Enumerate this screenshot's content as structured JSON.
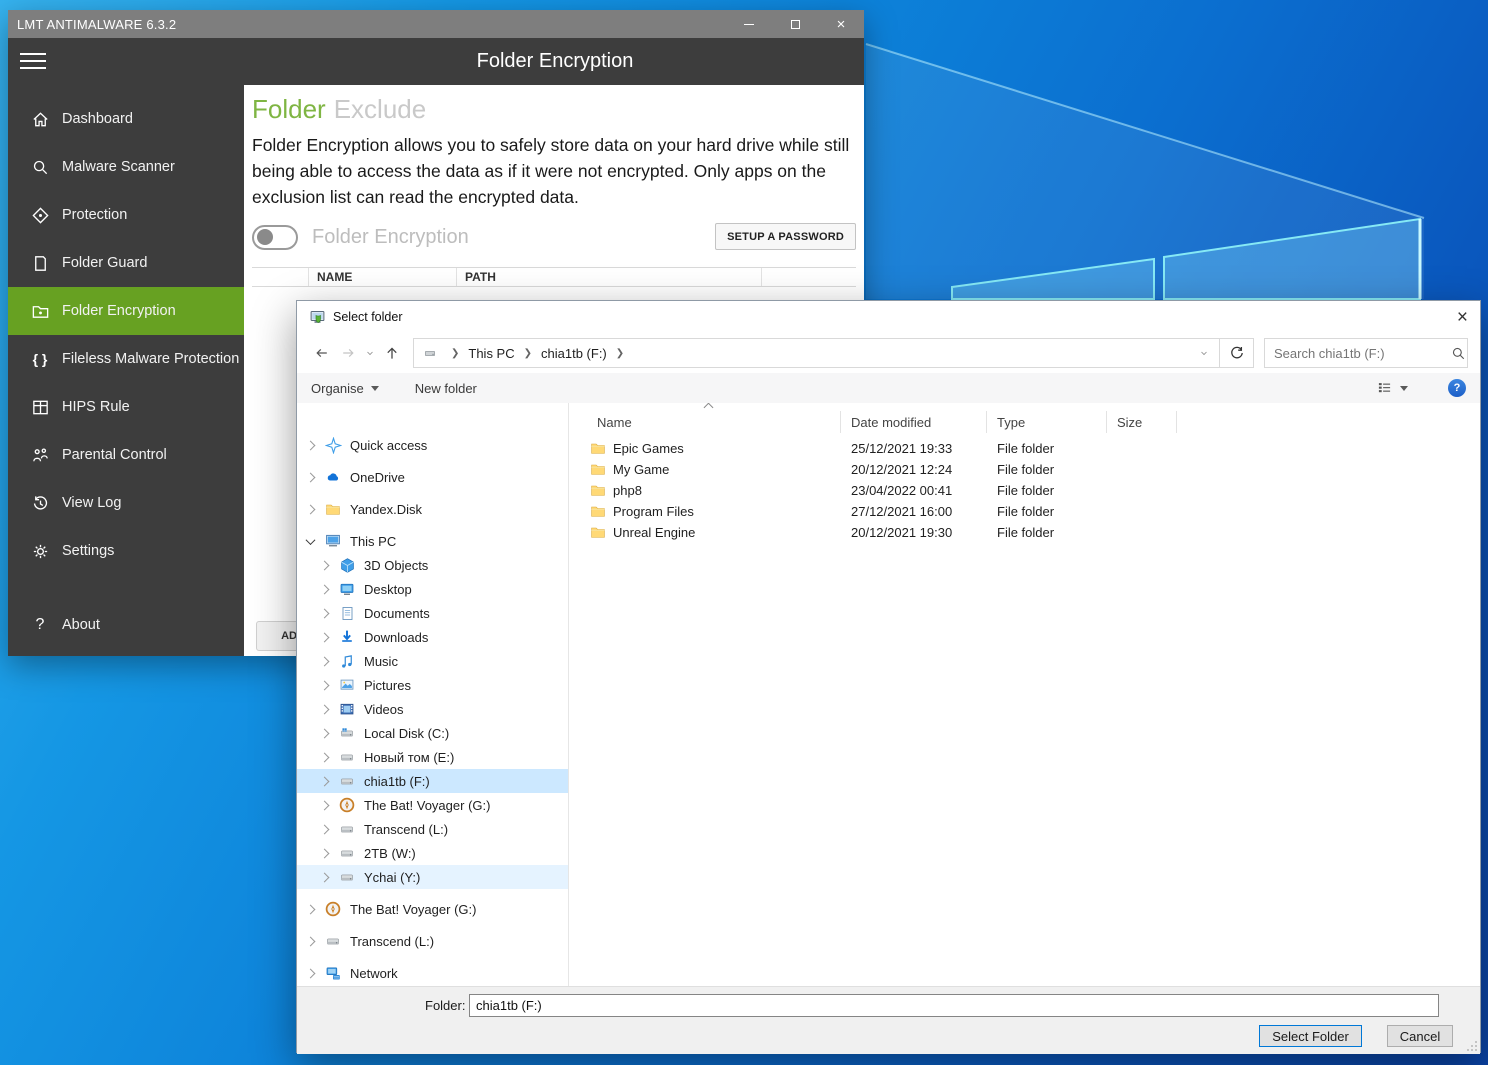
{
  "app": {
    "titlebar": {
      "title": "LMT ANTIMALWARE 6.3.2"
    },
    "header": {
      "title": "Folder Encryption"
    },
    "sidebar": {
      "items": [
        {
          "id": "dashboard",
          "label": "Dashboard",
          "icon": "home",
          "selected": false
        },
        {
          "id": "malware-scanner",
          "label": "Malware Scanner",
          "icon": "scan",
          "selected": false
        },
        {
          "id": "protection",
          "label": "Protection",
          "icon": "protection",
          "selected": false
        },
        {
          "id": "folder-guard",
          "label": "Folder Guard",
          "icon": "folder-guard",
          "selected": false
        },
        {
          "id": "folder-encryption",
          "label": "Folder Encryption",
          "icon": "folder-lock",
          "selected": true
        },
        {
          "id": "fileless-malware-protection",
          "label": "Fileless Malware Protection",
          "icon": "braces",
          "selected": false
        },
        {
          "id": "hips-rule",
          "label": "HIPS Rule",
          "icon": "hips",
          "selected": false
        },
        {
          "id": "parental-control",
          "label": "Parental Control",
          "icon": "parental",
          "selected": false
        },
        {
          "id": "view-log",
          "label": "View Log",
          "icon": "history",
          "selected": false
        },
        {
          "id": "settings",
          "label": "Settings",
          "icon": "gear",
          "selected": false
        },
        {
          "id": "about",
          "label": "About",
          "icon": "question",
          "selected": false
        }
      ]
    },
    "content": {
      "heading_primary": "Folder",
      "heading_secondary": "Exclude",
      "description": "Folder Encryption allows you to safely store data on your hard drive while still being able to access the data as if it were not encrypted. Only apps on the exclusion list can read the encrypted data.",
      "toggle_label": "Folder Encryption",
      "toggle_state": "off",
      "setup_password_button": "SETUP A PASSWORD",
      "table": {
        "columns": [
          "NAME",
          "PATH"
        ]
      },
      "add_button": "ADD"
    }
  },
  "dialog": {
    "title": "Select folder",
    "breadcrumb": {
      "segments": [
        "This PC",
        "chia1tb (F:)"
      ]
    },
    "search": {
      "placeholder": "Search chia1tb (F:)"
    },
    "toolbar": {
      "organise": "Organise",
      "new_folder": "New folder"
    },
    "tree": {
      "items": [
        {
          "label": "Quick access",
          "icon": "star",
          "level": 0,
          "expanded": false,
          "state": ""
        },
        {
          "label": "OneDrive",
          "icon": "cloud",
          "level": 0,
          "expanded": false,
          "state": ""
        },
        {
          "label": "Yandex.Disk",
          "icon": "folder",
          "level": 0,
          "expanded": false,
          "state": ""
        },
        {
          "label": "This PC",
          "icon": "pc",
          "level": 0,
          "expanded": true,
          "state": ""
        },
        {
          "label": "3D Objects",
          "icon": "cube",
          "level": 1,
          "expanded": false,
          "state": ""
        },
        {
          "label": "Desktop",
          "icon": "desktop",
          "level": 1,
          "expanded": false,
          "state": ""
        },
        {
          "label": "Documents",
          "icon": "document",
          "level": 1,
          "expanded": false,
          "state": ""
        },
        {
          "label": "Downloads",
          "icon": "download",
          "level": 1,
          "expanded": false,
          "state": ""
        },
        {
          "label": "Music",
          "icon": "music",
          "level": 1,
          "expanded": false,
          "state": ""
        },
        {
          "label": "Pictures",
          "icon": "picture",
          "level": 1,
          "expanded": false,
          "state": ""
        },
        {
          "label": "Videos",
          "icon": "video",
          "level": 1,
          "expanded": false,
          "state": ""
        },
        {
          "label": "Local Disk (C:)",
          "icon": "drive-os",
          "level": 1,
          "expanded": false,
          "state": ""
        },
        {
          "label": "Новый том (E:)",
          "icon": "drive",
          "level": 1,
          "expanded": false,
          "state": ""
        },
        {
          "label": "chia1tb (F:)",
          "icon": "drive",
          "level": 1,
          "expanded": false,
          "state": "selected"
        },
        {
          "label": "The Bat! Voyager (G:)",
          "icon": "voyager",
          "level": 1,
          "expanded": false,
          "state": ""
        },
        {
          "label": "Transcend (L:)",
          "icon": "drive",
          "level": 1,
          "expanded": false,
          "state": ""
        },
        {
          "label": "2TB (W:)",
          "icon": "drive",
          "level": 1,
          "expanded": false,
          "state": ""
        },
        {
          "label": "Ychai (Y:)",
          "icon": "drive",
          "level": 1,
          "expanded": false,
          "state": "hover"
        },
        {
          "label": "The Bat! Voyager (G:)",
          "icon": "voyager",
          "level": 0,
          "expanded": false,
          "state": ""
        },
        {
          "label": "Transcend (L:)",
          "icon": "drive",
          "level": 0,
          "expanded": false,
          "state": ""
        },
        {
          "label": "Network",
          "icon": "network",
          "level": 0,
          "expanded": false,
          "state": ""
        }
      ]
    },
    "files": {
      "columns": [
        "Name",
        "Date modified",
        "Type",
        "Size"
      ],
      "sorted_column": "Name",
      "rows": [
        {
          "name": "Epic Games",
          "date_modified": "25/12/2021 19:33",
          "type": "File folder",
          "size": ""
        },
        {
          "name": "My Game",
          "date_modified": "20/12/2021 12:24",
          "type": "File folder",
          "size": ""
        },
        {
          "name": "php8",
          "date_modified": "23/04/2022 00:41",
          "type": "File folder",
          "size": ""
        },
        {
          "name": "Program Files",
          "date_modified": "27/12/2021 16:00",
          "type": "File folder",
          "size": ""
        },
        {
          "name": "Unreal Engine",
          "date_modified": "20/12/2021 19:30",
          "type": "File folder",
          "size": ""
        }
      ]
    },
    "footer": {
      "folder_label": "Folder:",
      "folder_value": "chia1tb (F:)",
      "select_button": "Select Folder",
      "cancel_button": "Cancel"
    }
  },
  "colors": {
    "accent_green": "#67a122",
    "heading_green": "#7fb543",
    "titlebar_gray": "#7e7e7e",
    "sidebar_dark": "#3d3d3d",
    "selection_blue": "#cce8ff",
    "hover_blue": "#e5f3ff",
    "default_button_border": "#0078d7",
    "desktop_blue": "#0c7ed8"
  }
}
